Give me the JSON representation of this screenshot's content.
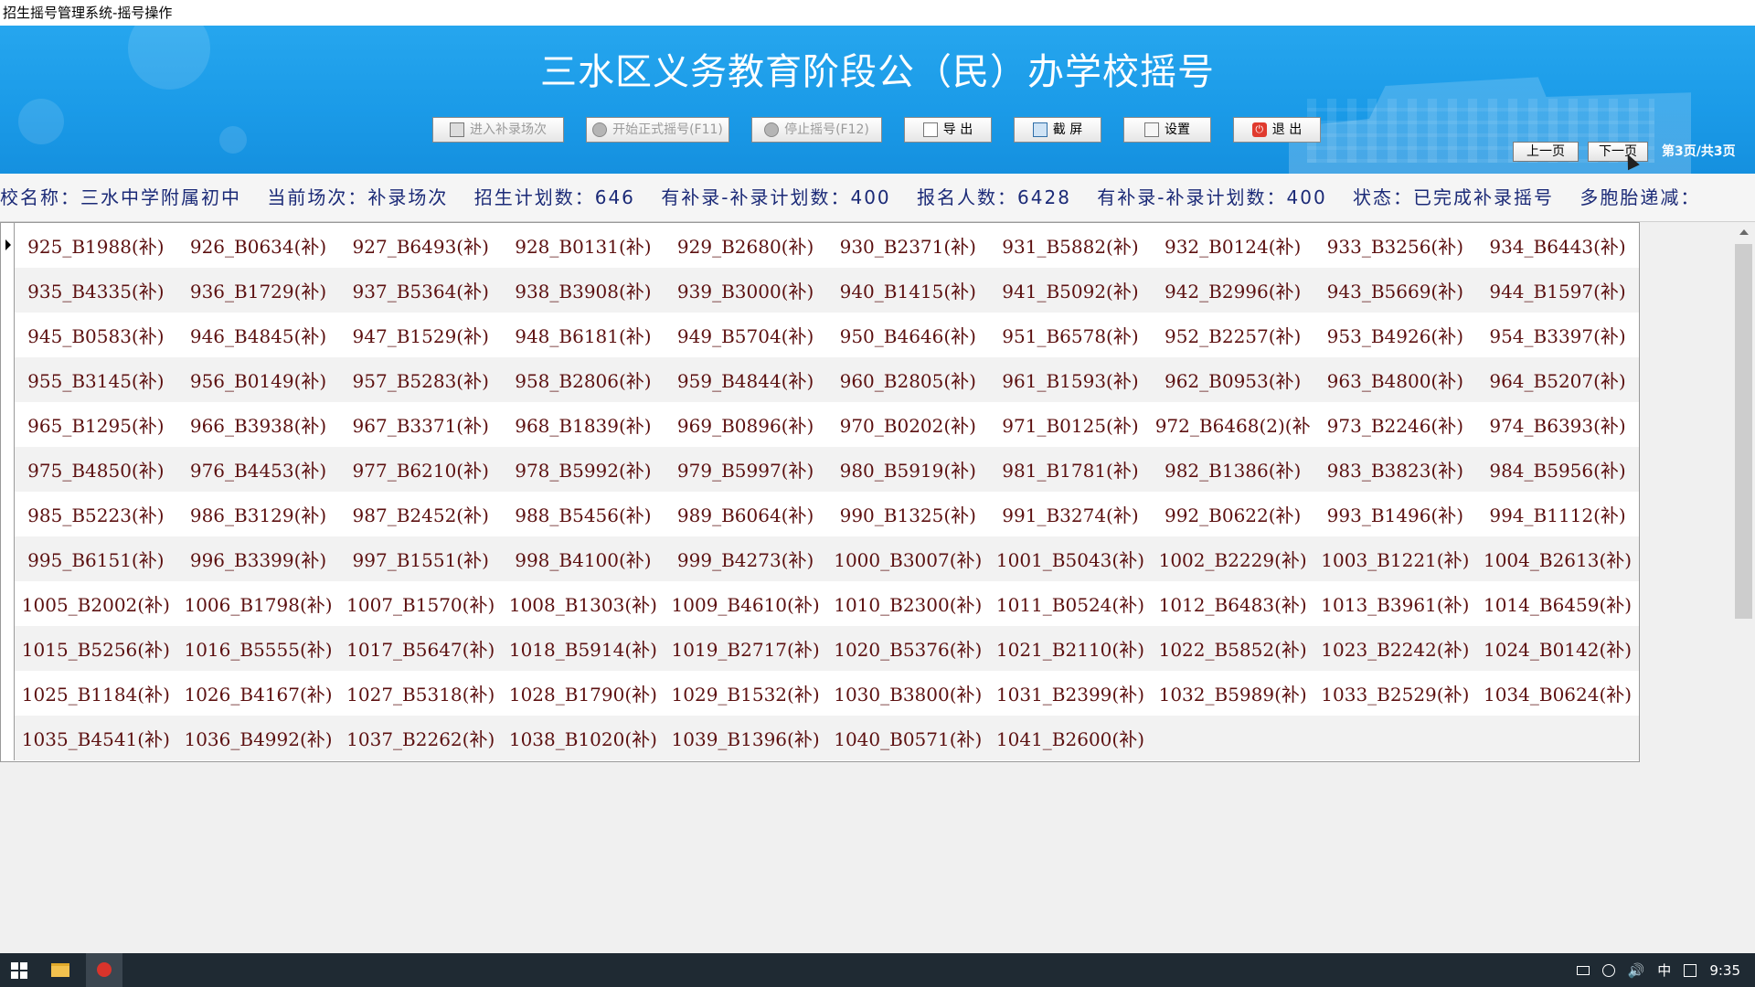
{
  "window": {
    "title": "招生摇号管理系统-摇号操作"
  },
  "banner": {
    "title": "三水区义务教育阶段公（民）办学校摇号"
  },
  "toolbar": {
    "enter_makeup": "进入补录场次",
    "start_formal": "开始正式摇号(F11)",
    "stop_draw": "停止摇号(F12)",
    "export": "导 出",
    "screenshot": "截 屏",
    "settings": "设置",
    "exit": "退 出"
  },
  "pager": {
    "prev": "上一页",
    "next": "下一页",
    "info": "第3页/共3页"
  },
  "infobar": {
    "school": "校名称：三水中学附属初中",
    "session": "当前场次：补录场次",
    "plan": "招生计划数：646",
    "makeup_plan_1": "有补录-补录计划数：400",
    "applicants": "报名人数：6428",
    "makeup_plan_2": "有补录-补录计划数：400",
    "status": "状态：已完成补录摇号",
    "multi": "多胞胎递减："
  },
  "grid": {
    "rows": [
      [
        "925_B1988(补)",
        "926_B0634(补)",
        "927_B6493(补)",
        "928_B0131(补)",
        "929_B2680(补)",
        "930_B2371(补)",
        "931_B5882(补)",
        "932_B0124(补)",
        "933_B3256(补)",
        "934_B6443(补)"
      ],
      [
        "935_B4335(补)",
        "936_B1729(补)",
        "937_B5364(补)",
        "938_B3908(补)",
        "939_B3000(补)",
        "940_B1415(补)",
        "941_B5092(补)",
        "942_B2996(补)",
        "943_B5669(补)",
        "944_B1597(补)"
      ],
      [
        "945_B0583(补)",
        "946_B4845(补)",
        "947_B1529(补)",
        "948_B6181(补)",
        "949_B5704(补)",
        "950_B4646(补)",
        "951_B6578(补)",
        "952_B2257(补)",
        "953_B4926(补)",
        "954_B3397(补)"
      ],
      [
        "955_B3145(补)",
        "956_B0149(补)",
        "957_B5283(补)",
        "958_B2806(补)",
        "959_B4844(补)",
        "960_B2805(补)",
        "961_B1593(补)",
        "962_B0953(补)",
        "963_B4800(补)",
        "964_B5207(补)"
      ],
      [
        "965_B1295(补)",
        "966_B3938(补)",
        "967_B3371(补)",
        "968_B1839(补)",
        "969_B0896(补)",
        "970_B0202(补)",
        "971_B0125(补)",
        "972_B6468(2)(补",
        "973_B2246(补)",
        "974_B6393(补)"
      ],
      [
        "975_B4850(补)",
        "976_B4453(补)",
        "977_B6210(补)",
        "978_B5992(补)",
        "979_B5997(补)",
        "980_B5919(补)",
        "981_B1781(补)",
        "982_B1386(补)",
        "983_B3823(补)",
        "984_B5956(补)"
      ],
      [
        "985_B5223(补)",
        "986_B3129(补)",
        "987_B2452(补)",
        "988_B5456(补)",
        "989_B6064(补)",
        "990_B1325(补)",
        "991_B3274(补)",
        "992_B0622(补)",
        "993_B1496(补)",
        "994_B1112(补)"
      ],
      [
        "995_B6151(补)",
        "996_B3399(补)",
        "997_B1551(补)",
        "998_B4100(补)",
        "999_B4273(补)",
        "1000_B3007(补)",
        "1001_B5043(补)",
        "1002_B2229(补)",
        "1003_B1221(补)",
        "1004_B2613(补)"
      ],
      [
        "1005_B2002(补)",
        "1006_B1798(补)",
        "1007_B1570(补)",
        "1008_B1303(补)",
        "1009_B4610(补)",
        "1010_B2300(补)",
        "1011_B0524(补)",
        "1012_B6483(补)",
        "1013_B3961(补)",
        "1014_B6459(补)"
      ],
      [
        "1015_B5256(补)",
        "1016_B5555(补)",
        "1017_B5647(补)",
        "1018_B5914(补)",
        "1019_B2717(补)",
        "1020_B5376(补)",
        "1021_B2110(补)",
        "1022_B5852(补)",
        "1023_B2242(补)",
        "1024_B0142(补)"
      ],
      [
        "1025_B1184(补)",
        "1026_B4167(补)",
        "1027_B5318(补)",
        "1028_B1790(补)",
        "1029_B1532(补)",
        "1030_B3800(补)",
        "1031_B2399(补)",
        "1032_B5989(补)",
        "1033_B2529(补)",
        "1034_B0624(补)"
      ],
      [
        "1035_B4541(补)",
        "1036_B4992(补)",
        "1037_B2262(补)",
        "1038_B1020(补)",
        "1039_B1396(补)",
        "1040_B0571(补)",
        "1041_B2600(补)",
        "",
        "",
        ""
      ]
    ]
  },
  "taskbar": {
    "ime": "中",
    "clock": "9:35"
  },
  "colors": {
    "banner": "#1b9be8",
    "cell_text": "#5c1010",
    "info_text": "#1b2a77"
  }
}
